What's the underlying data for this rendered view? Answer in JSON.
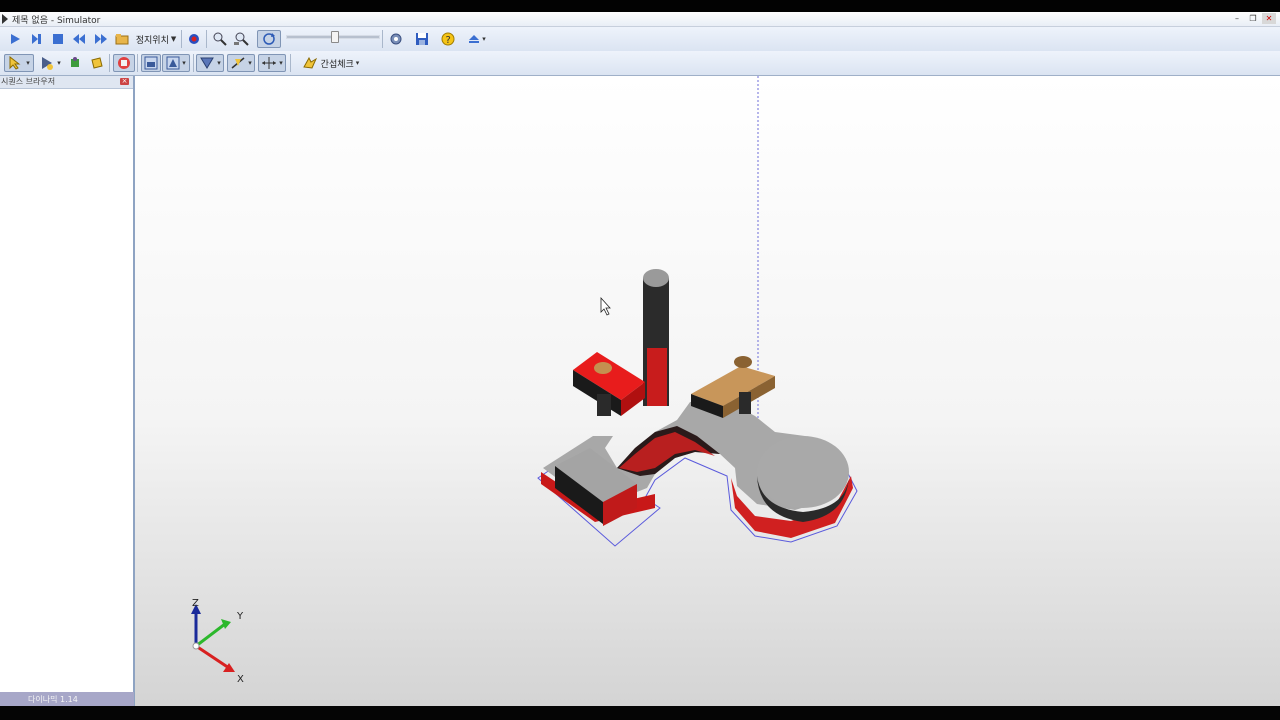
{
  "window": {
    "title": "제목 없음 - Simulator",
    "controls": [
      "minimize-icon",
      "restore-icon",
      "close-icon"
    ]
  },
  "toolbar_row1": {
    "stop_position_label": "정지위치",
    "tools": [
      "play-icon",
      "step-forward-icon",
      "stop-icon",
      "rewind-icon",
      "fast-forward-icon",
      "folder-icon",
      "record-icon",
      "zoom-icon",
      "zoom-fit-icon",
      "reset-view-icon",
      "settings-icon",
      "save-icon",
      "help-icon",
      "eject-icon"
    ]
  },
  "toolbar_row2": {
    "interference_check_label": "간섭체크",
    "tools": [
      "select-icon",
      "move-icon",
      "rotate-icon",
      "grab-icon",
      "tree-icon",
      "view-front-icon",
      "view-side-icon",
      "snap-icon",
      "axis-icon",
      "measure-icon",
      "interference-icon"
    ]
  },
  "sidebar": {
    "title": "시퀀스 브라우저"
  },
  "axis": {
    "z": "Z",
    "y": "Y",
    "x": "X"
  },
  "status": {
    "text": "다이나믹 1.14"
  },
  "colors": {
    "part_red": "#e01c1c",
    "part_tan": "#c8965a",
    "base_gray": "#a8a8a8",
    "outline_blue": "#5a5adc"
  }
}
